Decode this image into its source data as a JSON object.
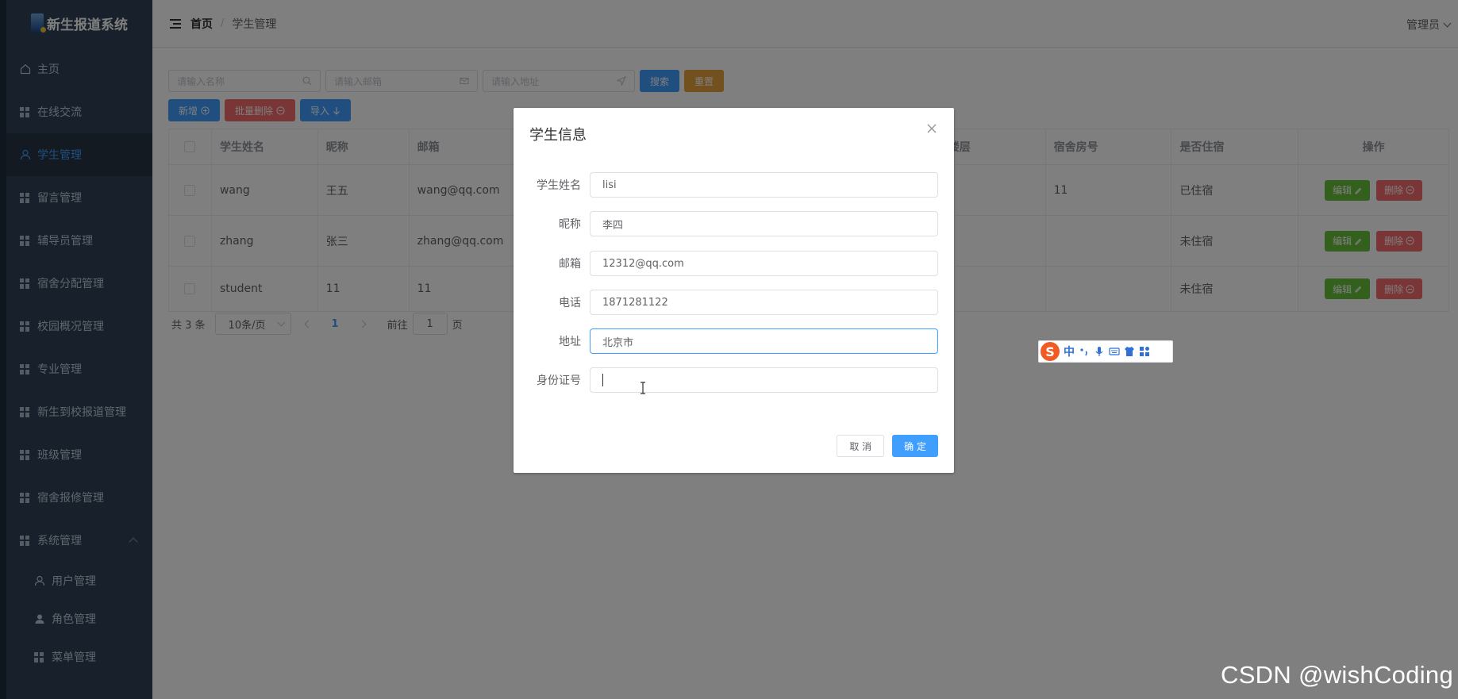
{
  "app": {
    "title": "新生报道系统"
  },
  "sidebar": {
    "items": [
      {
        "label": "主页",
        "icon": "home-icon"
      },
      {
        "label": "在线交流",
        "icon": "grid-icon"
      },
      {
        "label": "学生管理",
        "icon": "user-icon",
        "active": true
      },
      {
        "label": "留言管理",
        "icon": "grid-icon"
      },
      {
        "label": "辅导员管理",
        "icon": "grid-icon"
      },
      {
        "label": "宿舍分配管理",
        "icon": "grid-icon"
      },
      {
        "label": "校园概况管理",
        "icon": "grid-icon"
      },
      {
        "label": "专业管理",
        "icon": "grid-icon"
      },
      {
        "label": "新生到校报道管理",
        "icon": "grid-icon"
      },
      {
        "label": "班级管理",
        "icon": "grid-icon"
      },
      {
        "label": "宿舍报修管理",
        "icon": "grid-icon"
      },
      {
        "label": "系统管理",
        "icon": "grid-icon",
        "expanded": true
      }
    ],
    "sub_items": [
      {
        "label": "用户管理",
        "icon": "user-icon"
      },
      {
        "label": "角色管理",
        "icon": "user-filled-icon"
      },
      {
        "label": "菜单管理",
        "icon": "grid-icon"
      }
    ]
  },
  "header": {
    "breadcrumb_home": "首页",
    "breadcrumb_sep": "/",
    "breadcrumb_current": "学生管理",
    "user": "管理员"
  },
  "search": {
    "name_placeholder": "请输入名称",
    "email_placeholder": "请输入邮箱",
    "address_placeholder": "请输入地址",
    "search_label": "搜索",
    "reset_label": "重置"
  },
  "toolbar": {
    "add_label": "新增",
    "batch_delete_label": "批量删除",
    "import_label": "导入"
  },
  "table": {
    "columns": [
      "学生姓名",
      "昵称",
      "邮箱",
      "楼层",
      "宿舍房号",
      "是否住宿",
      "操作"
    ],
    "rows": [
      {
        "name": "wang",
        "nickname": "王五",
        "email": "wang@qq.com",
        "floor": "",
        "room": "11",
        "lodging": "已住宿"
      },
      {
        "name": "zhang",
        "nickname": "张三",
        "email": "zhang@qq.com",
        "floor": "",
        "room": "",
        "lodging": "未住宿"
      },
      {
        "name": "student",
        "nickname": "11",
        "email": "11",
        "floor": "",
        "room": "",
        "lodging": "未住宿"
      }
    ],
    "edit_label": "编辑",
    "delete_label": "删除"
  },
  "pagination": {
    "total": "共 3 条",
    "page_size": "10条/页",
    "current_page": "1",
    "goto_prefix": "前往",
    "goto_value": "1",
    "goto_suffix": "页"
  },
  "dialog": {
    "title": "学生信息",
    "fields": [
      {
        "label": "学生姓名",
        "value": "lisi"
      },
      {
        "label": "昵称",
        "value": "李四"
      },
      {
        "label": "邮箱",
        "value": "12312@qq.com"
      },
      {
        "label": "电话",
        "value": "1871281122"
      },
      {
        "label": "地址",
        "value": "北京市"
      },
      {
        "label": "身份证号",
        "value": ""
      }
    ],
    "cancel_label": "取 消",
    "confirm_label": "确 定"
  },
  "ime": {
    "mode": "中"
  },
  "watermark": "CSDN @wishCoding",
  "colors": {
    "primary": "#409eff",
    "success": "#67c23a",
    "danger": "#f56c6c",
    "warning": "#e6a23c",
    "sidebar": "#304156"
  }
}
